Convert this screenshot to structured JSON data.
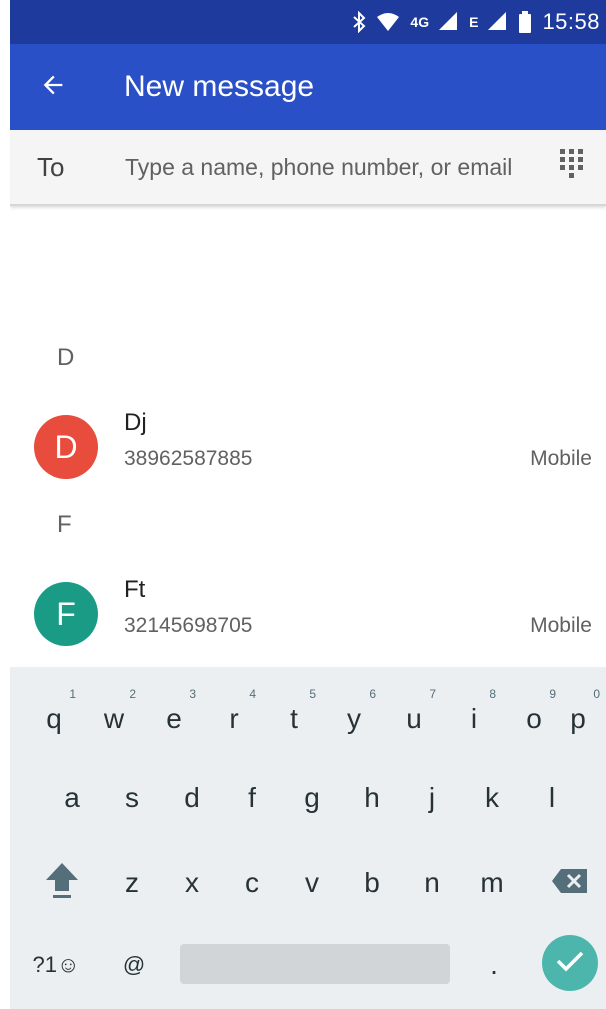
{
  "status_bar": {
    "network_label": "4G",
    "network_label_2": "E",
    "time": "15:58"
  },
  "app_bar": {
    "title": "New message"
  },
  "recipient": {
    "label": "To",
    "placeholder": "Type a name, phone number, or email",
    "value": ""
  },
  "contacts": {
    "sections": [
      {
        "header": "D",
        "items": [
          {
            "initial": "D",
            "name": "Dj",
            "number": "38962587885",
            "type": "Mobile",
            "avatar_color": "#e74c3c"
          }
        ]
      },
      {
        "header": "F",
        "items": [
          {
            "initial": "F",
            "name": "Ft",
            "number": "32145698705",
            "type": "Mobile",
            "avatar_color": "#1a9b86"
          }
        ]
      }
    ]
  },
  "keyboard": {
    "row1": [
      {
        "key": "q",
        "hint": "1"
      },
      {
        "key": "w",
        "hint": "2"
      },
      {
        "key": "e",
        "hint": "3"
      },
      {
        "key": "r",
        "hint": "4"
      },
      {
        "key": "t",
        "hint": "5"
      },
      {
        "key": "y",
        "hint": "6"
      },
      {
        "key": "u",
        "hint": "7"
      },
      {
        "key": "i",
        "hint": "8"
      },
      {
        "key": "o",
        "hint": "9"
      },
      {
        "key": "p",
        "hint": "0"
      }
    ],
    "row2": [
      "a",
      "s",
      "d",
      "f",
      "g",
      "h",
      "j",
      "k",
      "l"
    ],
    "row3": [
      "z",
      "x",
      "c",
      "v",
      "b",
      "n",
      "m"
    ],
    "symbols_label": "?1☺",
    "at_label": "@",
    "period_label": ".",
    "accent_color": "#4db6ac"
  },
  "icons": {
    "back": "arrow-left-icon",
    "dialpad": "dialpad-icon",
    "shift": "shift-icon",
    "backspace": "backspace-icon",
    "enter": "checkmark-icon",
    "bluetooth": "bluetooth-icon",
    "wifi": "wifi-icon",
    "signal": "signal-icon",
    "battery": "battery-icon"
  },
  "colors": {
    "status_bar": "#1e3a9c",
    "app_bar": "#2a50c8"
  }
}
